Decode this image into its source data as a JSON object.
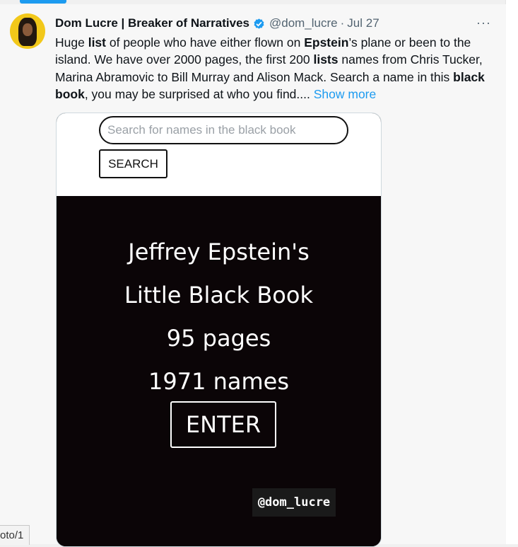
{
  "tweet": {
    "author": {
      "display_name": "Dom Lucre | Breaker of Narratives",
      "handle": "@dom_lucre",
      "separator": "·",
      "date": "Jul 27",
      "verified_icon": "verified-badge-icon"
    },
    "more_icon_label": "···",
    "text": {
      "p1": "Huge ",
      "b1": "list",
      "p2": " of people who have either flown on ",
      "b2": "Epstein",
      "p3": "’s plane or been to the island. We have over 2000 pages, the first 200 ",
      "b3": "lists",
      "p4": " names from Chris Tucker, Marina Abramovic to Bill Murray and Alison Mack. Search a name in this ",
      "b4": "black book",
      "p5": ", you may be surprised at who you find.... ",
      "show_more": "Show more"
    },
    "card": {
      "search_placeholder": "Search for names in the black book",
      "search_button": "SEARCH",
      "line1": "Jeffrey Epstein's",
      "line2": "Little Black Book",
      "line3": "95 pages",
      "line4": "1971 names",
      "enter_button": "ENTER",
      "watermark": "@dom_lucre"
    }
  },
  "status_bar": {
    "url_text": "oto/1"
  },
  "colors": {
    "accent": "#1d9bf0",
    "verified": "#1d9bf0",
    "card_background": "#0b0507",
    "text_primary": "#0f1419",
    "text_secondary": "#536471"
  }
}
